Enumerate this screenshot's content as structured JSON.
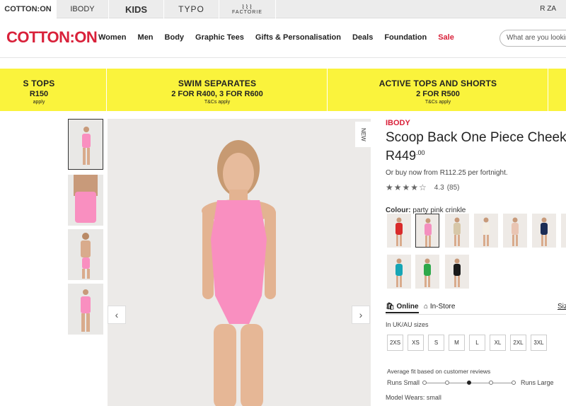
{
  "brand_tabs": [
    "COTTON:ON",
    "IBODY",
    "KIDS",
    "TYPO",
    "FACTORIE"
  ],
  "region": "R ZA",
  "logo": "COTTON:ON",
  "nav": [
    "Women",
    "Men",
    "Body",
    "Graphic Tees",
    "Gifts & Personalisation",
    "Deals",
    "Foundation",
    "Sale"
  ],
  "search_placeholder": "What are you looking for?",
  "promo": [
    {
      "title": "S TOPS",
      "sub": "R150",
      "tc": "apply"
    },
    {
      "title": "SWIM SEPARATES",
      "sub": "2 FOR R400, 3 FOR R600",
      "tc": "T&Cs apply"
    },
    {
      "title": "ACTIVE TOPS AND SHORTS",
      "sub": "2 FOR R500",
      "tc": "T&Cs apply"
    }
  ],
  "new_badge": "NEW",
  "product": {
    "brand": "IBODY",
    "title": "Scoop Back One Piece Cheeky",
    "price": "R449",
    "price_cents": ".00",
    "afterpay": "Or buy now from R112.25 per fortnight.",
    "rating": "4.3",
    "review_count": "(85)",
    "colour_label": "Colour:",
    "colour_value": "party pink crinkle"
  },
  "swatch_colors": [
    "#d92b2b",
    "#f48fbf",
    "#d7c7a8",
    "#f3ede2",
    "#e9c5b3",
    "#1b2c55",
    "#6b5b4b",
    "#16a5b5",
    "#2ea84a",
    "#1a1a1a"
  ],
  "tabs": {
    "online": "Online",
    "instore": "In-Store",
    "size_guide": "Siz"
  },
  "size_note": "In UK/AU sizes",
  "sizes": [
    "2XS",
    "XS",
    "S",
    "M",
    "L",
    "XL",
    "2XL",
    "3XL"
  ],
  "fit": {
    "title": "Average fit based on customer reviews",
    "small": "Runs Small",
    "large": "Runs Large",
    "position": 0.5
  },
  "model_wears": "Model Wears: small",
  "colors": {
    "brand_red": "#d9213a",
    "promo_yellow": "#faf33c",
    "swim_pink": "#f98fc0"
  },
  "icons": [
    "bag-icon",
    "store-icon",
    "chevron-left-icon",
    "chevron-right-icon",
    "star-icon"
  ]
}
